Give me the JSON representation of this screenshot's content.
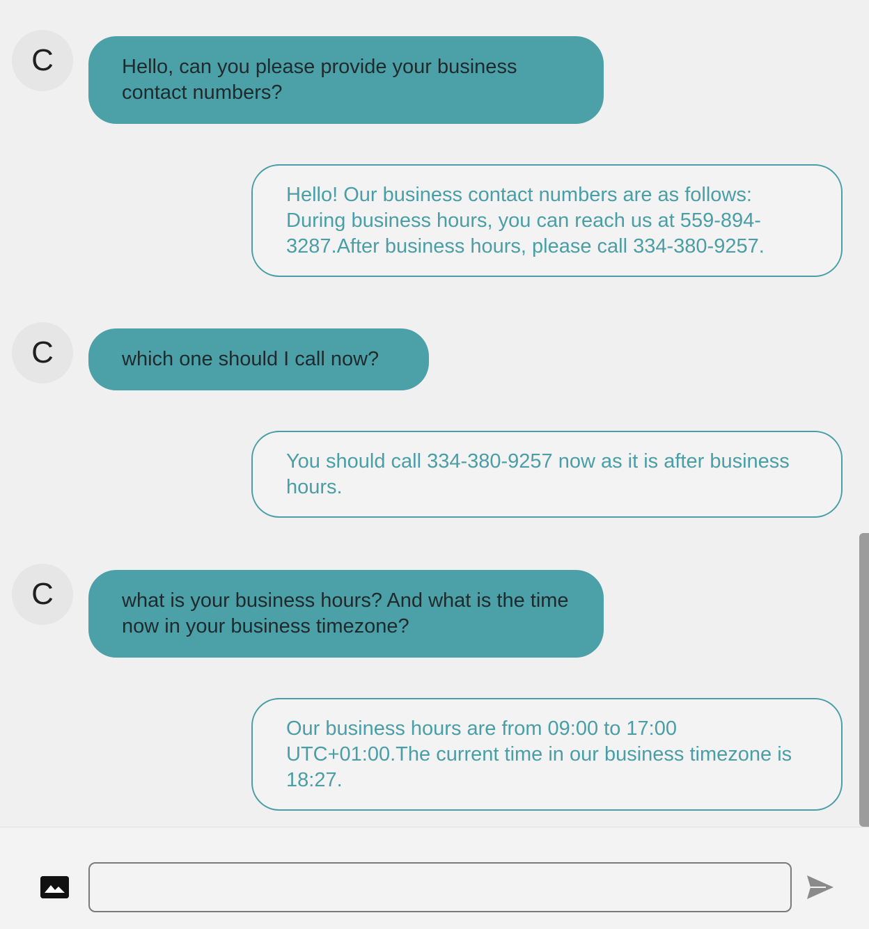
{
  "messages": [
    {
      "role": "user",
      "avatar_letter": "C",
      "text": "Hello, can you please provide your business contact numbers?"
    },
    {
      "role": "assistant",
      "text": "Hello! Our business contact numbers are as follows: During business hours, you can reach us at 559-894-3287.After business hours, please call 334-380-9257."
    },
    {
      "role": "user",
      "avatar_letter": "C",
      "text": "which one should I call now?"
    },
    {
      "role": "assistant",
      "text": "You should call 334-380-9257 now as it is after business hours."
    },
    {
      "role": "user",
      "avatar_letter": "C",
      "text": "what is your business hours? And what is the time now in your business timezone?"
    },
    {
      "role": "assistant",
      "text": "Our business hours are from 09:00 to 17:00 UTC+01:00.The current time in our business timezone is 18:27."
    }
  ],
  "composer": {
    "value": "",
    "placeholder": "",
    "image_icon": "image-icon",
    "send_icon": "send-icon"
  },
  "colors": {
    "user_bubble": "#4ca0a8",
    "assistant_text": "#4a9ea6",
    "background": "#f0f0f0"
  }
}
